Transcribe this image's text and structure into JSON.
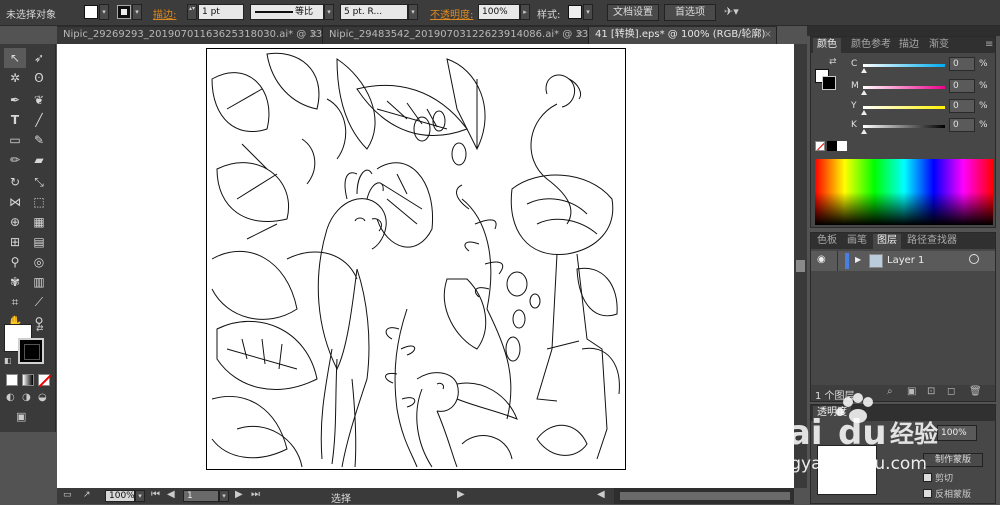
{
  "control_bar": {
    "selection_status": "未选择对象",
    "stroke_label": "描边:",
    "stroke_weight": "1 pt",
    "stroke_profile": "等比",
    "brush": "5 pt. R...",
    "opacity_label": "不透明度:",
    "opacity_value": "100%",
    "style_label": "样式:",
    "doc_setup_button": "文档设置",
    "preferences_button": "首选项"
  },
  "tabs": [
    {
      "label": "Nipic_29269293_20190701163625318030.ai* @ 33...",
      "active": false
    },
    {
      "label": "Nipic_29483542_20190703122623914086.ai* @ 33...",
      "active": false
    },
    {
      "label": "41 [转换].eps* @ 100% (RGB/轮廓)",
      "active": true
    }
  ],
  "color_panel": {
    "tabs": [
      "颜色",
      "颜色参考",
      "描边",
      "渐变"
    ],
    "channels": [
      {
        "label": "C",
        "value": "0",
        "unit": "%",
        "gradient": [
          "#ffffff",
          "#00aeef"
        ]
      },
      {
        "label": "M",
        "value": "0",
        "unit": "%",
        "gradient": [
          "#ffffff",
          "#ec008c"
        ]
      },
      {
        "label": "Y",
        "value": "0",
        "unit": "%",
        "gradient": [
          "#ffffff",
          "#fff200"
        ]
      },
      {
        "label": "K",
        "value": "0",
        "unit": "%",
        "gradient": [
          "#ffffff",
          "#000000"
        ]
      }
    ]
  },
  "layers_panel": {
    "tabs": [
      "色板",
      "画笔",
      "图层",
      "路径查找器"
    ],
    "layers": [
      {
        "name": "Layer 1",
        "visible": true
      }
    ],
    "footer_count": "1 个图层"
  },
  "transparency_panel": {
    "title": "透明度",
    "opacity_value": "100%",
    "make_mask_button": "制作蒙版",
    "clip_option": "剪切",
    "invert_option": "反相蒙版"
  },
  "status_bar": {
    "zoom": "100%",
    "page": "1",
    "tool": "选择"
  },
  "watermark": {
    "logo": "Bai du 经验",
    "url": "jingyan.baidu.com"
  }
}
